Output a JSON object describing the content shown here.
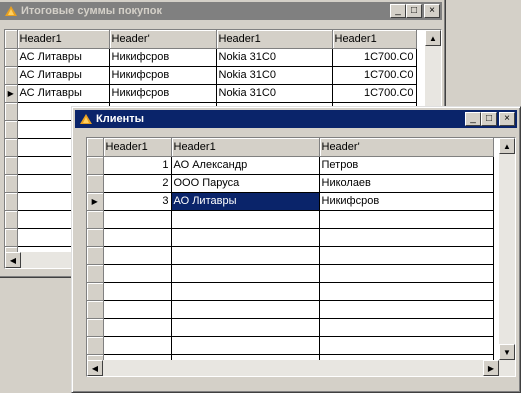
{
  "window_back": {
    "title": "Итоговые суммы покупок",
    "headers": [
      "Header1",
      "Header'",
      "Header1",
      "Header1"
    ],
    "rows": [
      [
        "АС Литавры",
        "Никифсров",
        "Nokia 31С0",
        "1С700.С0"
      ],
      [
        "АС Литавры",
        "Никифсров",
        "Nokia 31С0",
        "1С700.С0"
      ],
      [
        "АС Литавры",
        "Никифсров",
        "Nokia 31С0",
        "1С700.С0"
      ]
    ]
  },
  "window_front": {
    "title": "Клиенты",
    "headers": [
      "Header1",
      "Header1",
      "Header'"
    ],
    "rows": [
      [
        "1",
        "АО Александр",
        "Петров"
      ],
      [
        "2",
        "ООО Паруса",
        "Николаев"
      ],
      [
        "3",
        "АО Литавры",
        "Никифсров"
      ]
    ]
  },
  "controls": {
    "minimize": "_",
    "maximize": "□",
    "close": "×"
  },
  "colors": {
    "active_title": "#0a246a",
    "inactive_title": "#808080",
    "face": "#d4d0c8"
  }
}
